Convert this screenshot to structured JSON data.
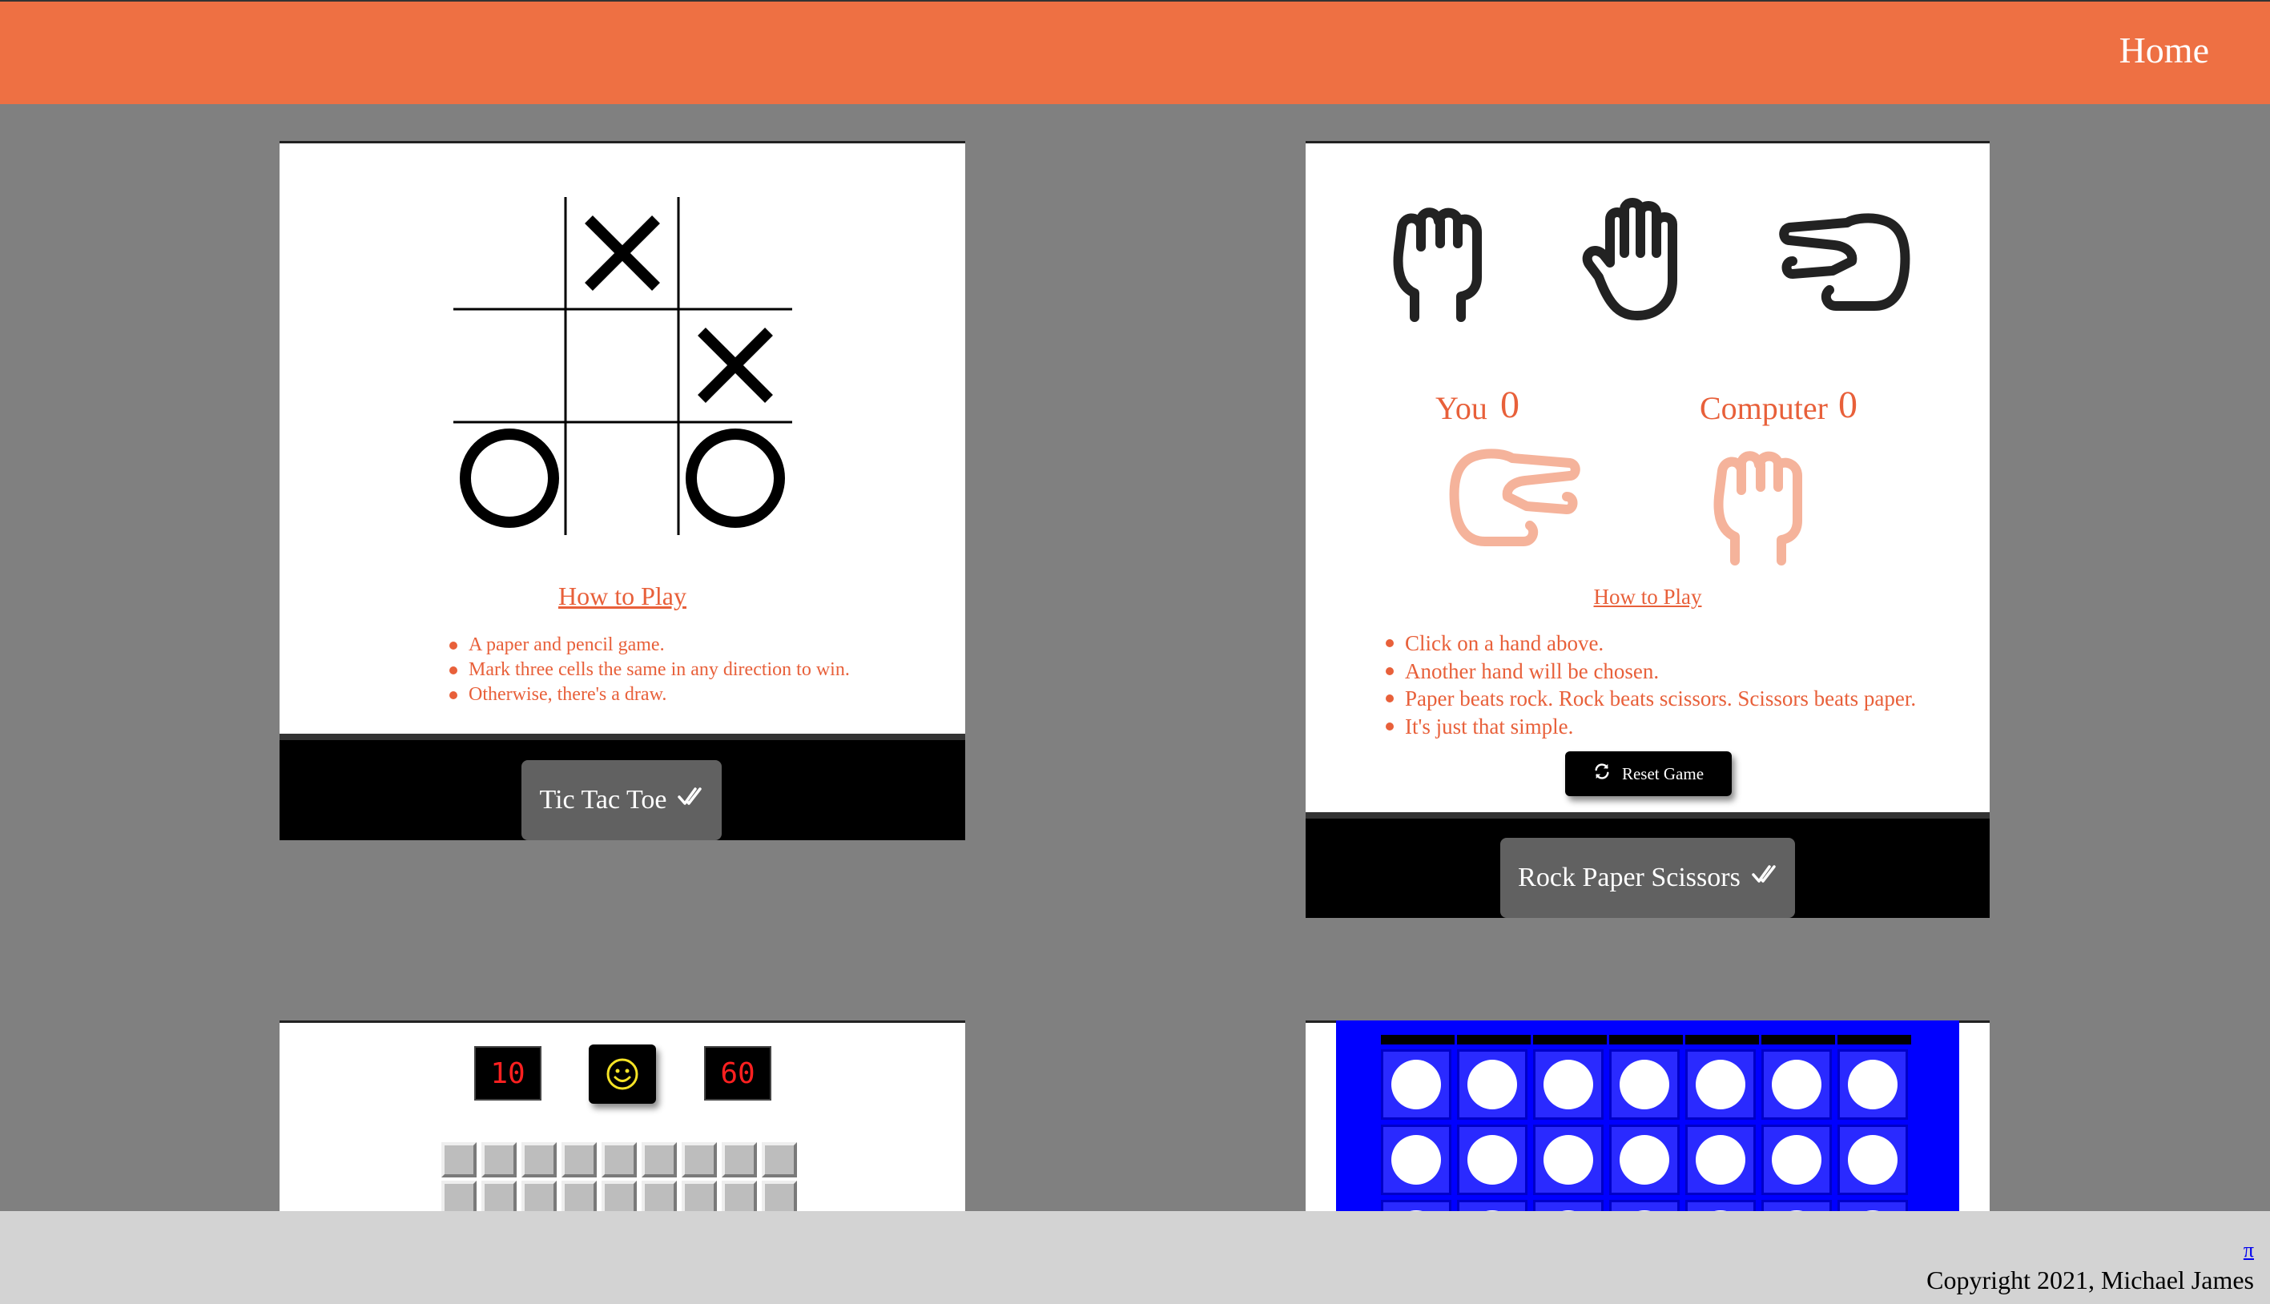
{
  "nav": {
    "home_label": "Home"
  },
  "tictactoe": {
    "board": [
      "",
      "X",
      "",
      "",
      "",
      "X",
      "O",
      "",
      "O"
    ],
    "how_to_label": "How to Play",
    "rules": [
      "A paper and pencil game.",
      "Mark three cells the same in any direction to win.",
      "Otherwise, there's a draw."
    ],
    "button_label": "Tic Tac Toe",
    "button_icon": "double-check-icon"
  },
  "rps": {
    "hands": [
      {
        "name": "rock",
        "icon": "rock-hand-icon"
      },
      {
        "name": "paper",
        "icon": "paper-hand-icon"
      },
      {
        "name": "scissors",
        "icon": "scissors-hand-icon"
      }
    ],
    "you_label": "You",
    "you_score": "0",
    "computer_label": "Computer",
    "computer_score": "0",
    "you_choice_icon": "scissors-hand-icon",
    "computer_choice_icon": "rock-hand-icon",
    "how_to_label": "How to Play",
    "rules": [
      "Click on a hand above.",
      "Another hand will be chosen.",
      "Paper beats rock. Rock beats scissors. Scissors beats paper.",
      "It's just that simple."
    ],
    "reset_label": "Reset Game",
    "reset_icon": "refresh-icon",
    "button_label": "Rock Paper Scissors",
    "button_icon": "double-check-icon"
  },
  "minesweeper": {
    "mines_counter": "10",
    "timer": "60",
    "face_icon": "smiley-face-icon"
  },
  "connect_four": {
    "board_color": "#0000ff"
  },
  "footer": {
    "pi_link": "π",
    "copyright": "Copyright 2021, Michael James"
  },
  "colors": {
    "header": "#ee7043",
    "accent_text": "#e8603a",
    "background": "#808080",
    "footer": "#d3d3d3"
  }
}
